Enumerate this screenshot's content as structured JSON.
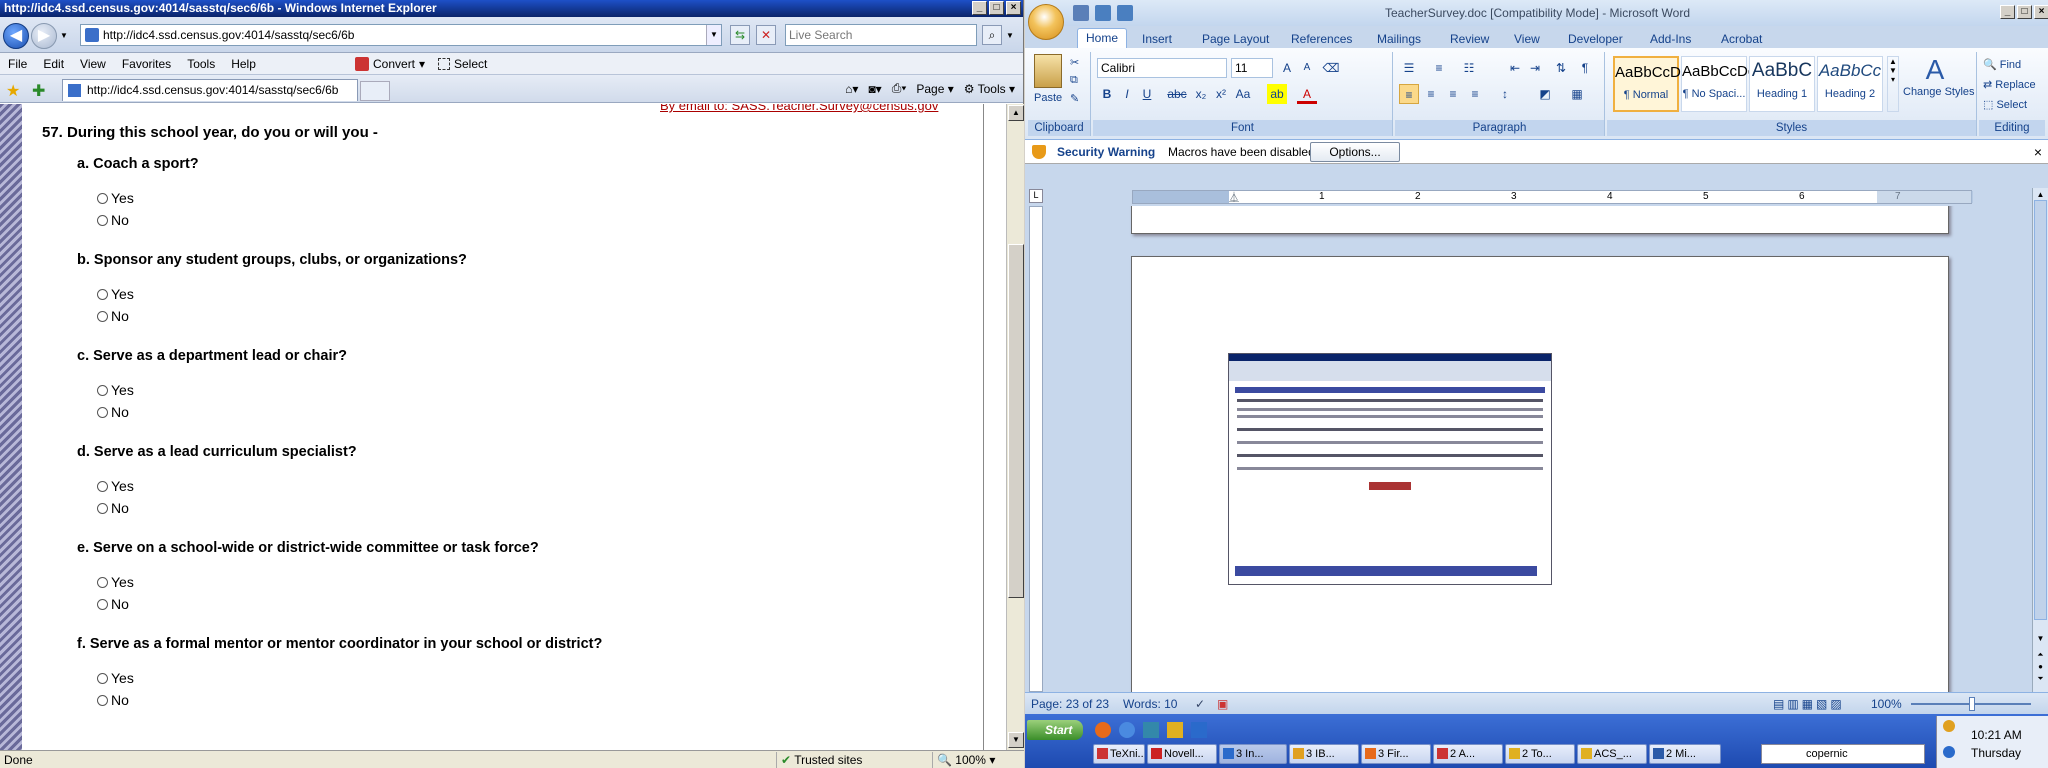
{
  "ie": {
    "title": "http://idc4.ssd.census.gov:4014/sasstq/sec6/6b - Windows Internet Explorer",
    "address": "http://idc4.ssd.census.gov:4014/sasstq/sec6/6b",
    "search_placeholder": "Live Search",
    "menu": [
      "File",
      "Edit",
      "View",
      "Favorites",
      "Tools",
      "Help"
    ],
    "convert_label": "Convert",
    "select_label": "Select",
    "tab_title": "http://idc4.ssd.census.gov:4014/sasstq/sec6/6b",
    "tab_tools": {
      "page": "Page",
      "tools": "Tools"
    },
    "status": {
      "left": "Done",
      "zone": "Trusted sites",
      "zoom": "100%"
    }
  },
  "survey": {
    "question": "57. During this school year, do you or will you -",
    "partial_link": "By email to: SASS.Teacher.Survey@census.gov",
    "items": [
      {
        "label": "a. Coach a sport?",
        "options": [
          "Yes",
          "No"
        ]
      },
      {
        "label": "b. Sponsor any student groups, clubs, or organizations?",
        "options": [
          "Yes",
          "No"
        ]
      },
      {
        "label": "c. Serve as a department lead or chair?",
        "options": [
          "Yes",
          "No"
        ]
      },
      {
        "label": "d. Serve as a lead curriculum specialist?",
        "options": [
          "Yes",
          "No"
        ]
      },
      {
        "label": "e. Serve on a school-wide or district-wide committee or task force?",
        "options": [
          "Yes",
          "No"
        ]
      },
      {
        "label": "f. Serve as a formal mentor or mentor coordinator in your school or district?",
        "options": [
          "Yes",
          "No"
        ]
      }
    ]
  },
  "word": {
    "title": "TeacherSurvey.doc [Compatibility Mode] - Microsoft Word",
    "tabs": [
      "Home",
      "Insert",
      "Page Layout",
      "References",
      "Mailings",
      "Review",
      "View",
      "Developer",
      "Add-Ins",
      "Acrobat"
    ],
    "font_name": "Calibri",
    "font_size": "11",
    "groups": {
      "clipboard": "Clipboard",
      "font": "Font",
      "paragraph": "Paragraph",
      "styles": "Styles",
      "editing": "Editing"
    },
    "paste_label": "Paste",
    "styles": [
      {
        "preview": "AaBbCcDc",
        "name": "¶ Normal"
      },
      {
        "preview": "AaBbCcDc",
        "name": "¶ No Spaci..."
      },
      {
        "preview": "AaBbC",
        "name": "Heading 1"
      },
      {
        "preview": "AaBbCc",
        "name": "Heading 2"
      }
    ],
    "change_styles": "Change Styles",
    "editing": {
      "find": "Find",
      "replace": "Replace",
      "select": "Select"
    },
    "security": {
      "title": "Security Warning",
      "message": "Macros have been disabled.",
      "options_button": "Options..."
    },
    "ruler_numbers": [
      "1",
      "2",
      "3",
      "4",
      "5",
      "6",
      "7"
    ],
    "status": {
      "page": "Page: 23 of 23",
      "words": "Words: 10",
      "zoom": "100%"
    }
  },
  "taskbar": {
    "start": "Start",
    "buttons": [
      "TeXni...",
      "Novell...",
      "3 In...",
      "3 IB...",
      "3 Fir...",
      "2 A...",
      "2 To...",
      "ACS_...",
      "2 Mi..."
    ],
    "search_value": "copernic",
    "clock": "10:21 AM",
    "day": "Thursday"
  }
}
